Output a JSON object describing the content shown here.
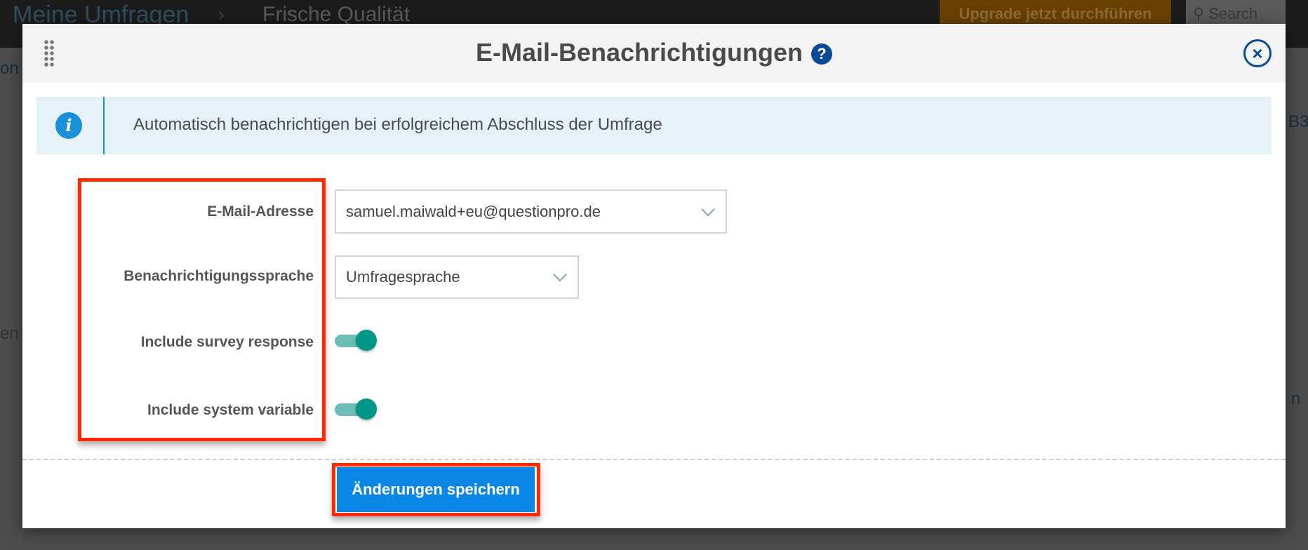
{
  "background": {
    "breadcrumb": [
      "Meine Umfragen",
      "Frische Qualität"
    ],
    "breadcrumb_separator": "›",
    "upgrade_label": "Upgrade jetzt durchführen",
    "search_label": "Search",
    "side_fragments": [
      "on",
      "en",
      "B3",
      "n"
    ]
  },
  "modal": {
    "title": "E-Mail-Benachrichtigungen",
    "help_icon": "?",
    "close_icon": "×",
    "info_icon": "i",
    "info_text": "Automatisch benachrichtigen bei erfolgreichem Abschluss der Umfrage",
    "fields": {
      "email": {
        "label": "E-Mail-Adresse",
        "value": "samuel.maiwald+eu@questionpro.de"
      },
      "language": {
        "label": "Benachrichtigungssprache",
        "value": "Umfragesprache"
      },
      "include_response": {
        "label": "Include survey response",
        "on": true
      },
      "include_system_variable": {
        "label": "Include system variable",
        "on": true
      }
    },
    "save_label": "Änderungen speichern"
  },
  "colors": {
    "accent": "#0a86e6",
    "toggle": "#009688",
    "highlight": "#ff2a00"
  }
}
